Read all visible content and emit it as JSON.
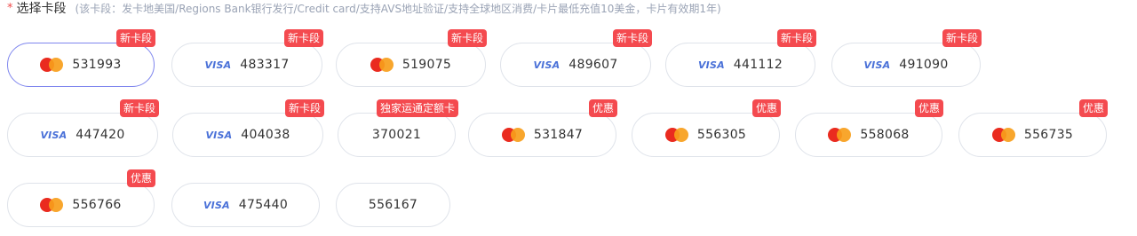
{
  "header": {
    "required_mark": "*",
    "title": "选择卡段",
    "note": "(该卡段：发卡地美国/Regions Bank银行发行/Credit card/支持AVS地址验证/支持全球地区消费/卡片最低充值10美金，卡片有效期1年)"
  },
  "colors": {
    "tag_bg": "#f44a4f",
    "selected_border": "#7f86ee",
    "visa_blue": "#4a71d8",
    "mc_red": "#ea2b1f",
    "mc_orange": "#f79e1b"
  },
  "cards": [
    {
      "number": "531993",
      "brand": "mastercard",
      "tag": "新卡段",
      "selected": true
    },
    {
      "number": "483317",
      "brand": "visa",
      "brand_text": "VISA",
      "tag": "新卡段"
    },
    {
      "number": "519075",
      "brand": "mastercard",
      "tag": "新卡段"
    },
    {
      "number": "489607",
      "brand": "visa",
      "brand_text": "VISA",
      "tag": "新卡段"
    },
    {
      "number": "441112",
      "brand": "visa",
      "brand_text": "VISA",
      "tag": "新卡段"
    },
    {
      "number": "491090",
      "brand": "visa",
      "brand_text": "VISA",
      "tag": "新卡段"
    },
    {
      "number": "447420",
      "brand": "visa",
      "brand_text": "VISA",
      "tag": "新卡段"
    },
    {
      "number": "404038",
      "brand": "visa",
      "brand_text": "VISA",
      "tag": "新卡段"
    },
    {
      "number": "370021",
      "brand": "none",
      "tag": "独家运通定额卡"
    },
    {
      "number": "531847",
      "brand": "mastercard",
      "tag": "优惠"
    },
    {
      "number": "556305",
      "brand": "mastercard",
      "tag": "优惠"
    },
    {
      "number": "558068",
      "brand": "mastercard",
      "tag": "优惠"
    },
    {
      "number": "556735",
      "brand": "mastercard",
      "tag": "优惠"
    },
    {
      "number": "556766",
      "brand": "mastercard",
      "tag": "优惠"
    },
    {
      "number": "475440",
      "brand": "visa",
      "brand_text": "VISA",
      "tag": ""
    },
    {
      "number": "556167",
      "brand": "none",
      "tag": ""
    }
  ]
}
